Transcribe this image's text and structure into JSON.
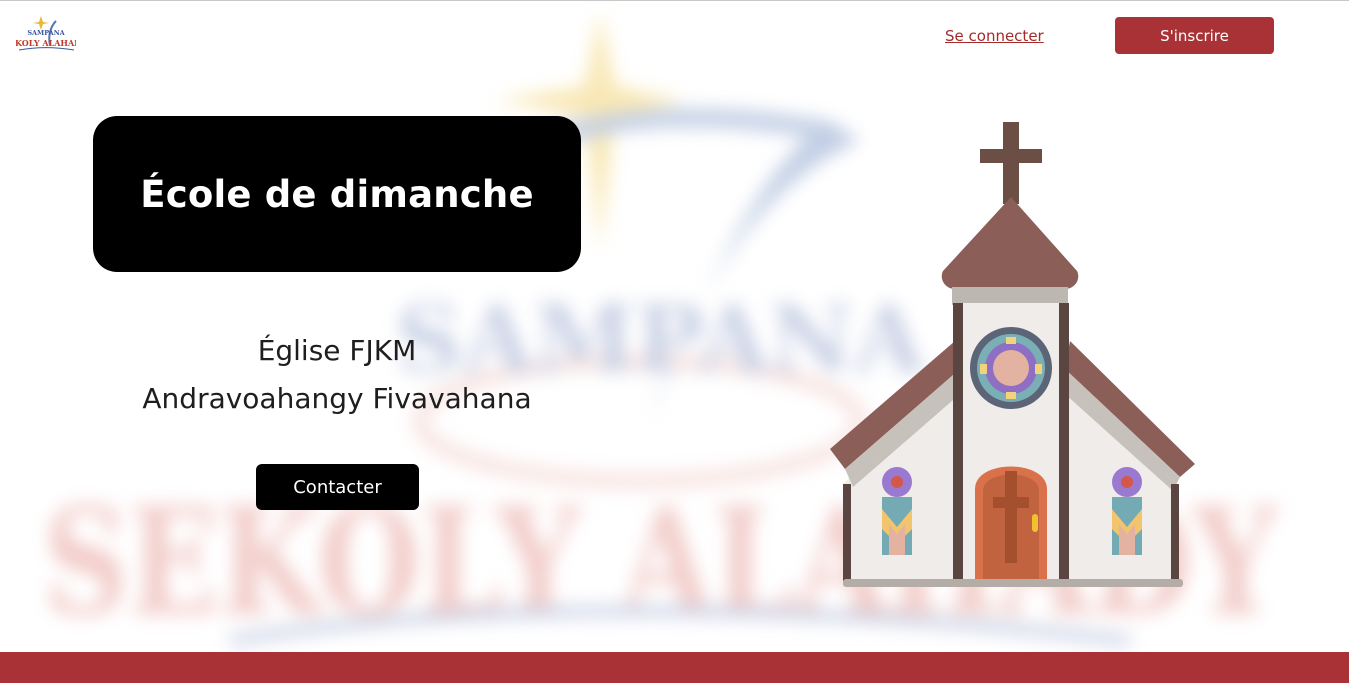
{
  "header": {
    "logo_text_top": "SAMPANA",
    "logo_text_bottom": "SEKOLY ALAHADY",
    "login_label": "Se connecter",
    "signup_label": "S'inscrire"
  },
  "hero": {
    "title": "École de dimanche",
    "subtitle_line1": "Église FJKM",
    "subtitle_line2": "Andravoahangy Fivavahana",
    "contact_label": "Contacter"
  },
  "watermark": {
    "text_top": "SAMPANA",
    "text_bottom": "SEKOLY ALAHADY"
  },
  "colors": {
    "brand_red": "#a83236",
    "link_red": "#a52a2a",
    "black": "#000000",
    "church_roof": "#8b5e57",
    "church_wall": "#efecea"
  },
  "icons": {
    "logo": "sampana-sekoly-alahady-logo",
    "church": "church-illustration-icon"
  }
}
